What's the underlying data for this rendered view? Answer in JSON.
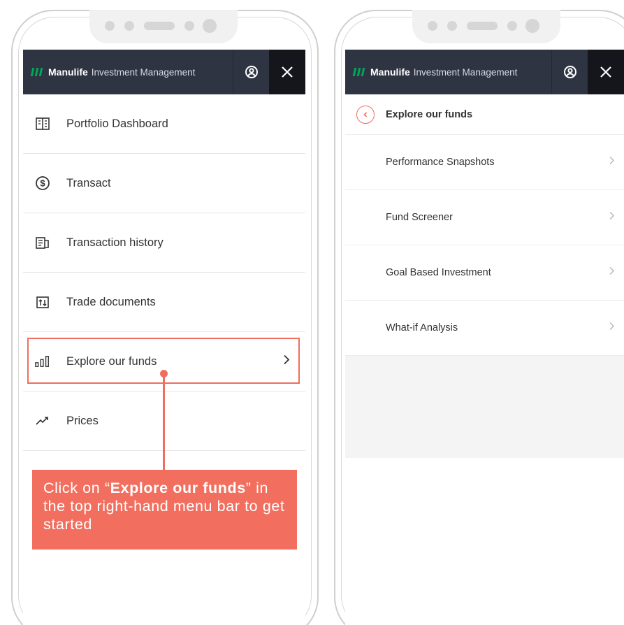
{
  "header": {
    "brand_name": "Manulife",
    "brand_sub": "Investment Management"
  },
  "left_menu": {
    "items": [
      {
        "label": "Portfolio Dashboard",
        "icon": "dashboard-icon"
      },
      {
        "label": "Transact",
        "icon": "dollar-icon"
      },
      {
        "label": "Transaction history",
        "icon": "history-icon"
      },
      {
        "label": "Trade documents",
        "icon": "trade-documents-icon"
      },
      {
        "label": "Explore our funds",
        "icon": "bar-chart-icon",
        "highlighted": true
      },
      {
        "label": "Prices",
        "icon": "trend-icon"
      }
    ]
  },
  "callout": {
    "prefix": "Click on “",
    "emphasis": "Explore our funds",
    "suffix": "” in the top right-hand menu bar to get started"
  },
  "right_menu": {
    "title": "Explore our funds",
    "items": [
      {
        "label": "Performance Snapshots"
      },
      {
        "label": "Fund Screener"
      },
      {
        "label": "Goal Based Investment"
      },
      {
        "label": "What-if Analysis"
      }
    ]
  },
  "colors": {
    "header_bg": "#2f3443",
    "brand_green": "#00a758",
    "accent_coral": "#f26f5f"
  }
}
